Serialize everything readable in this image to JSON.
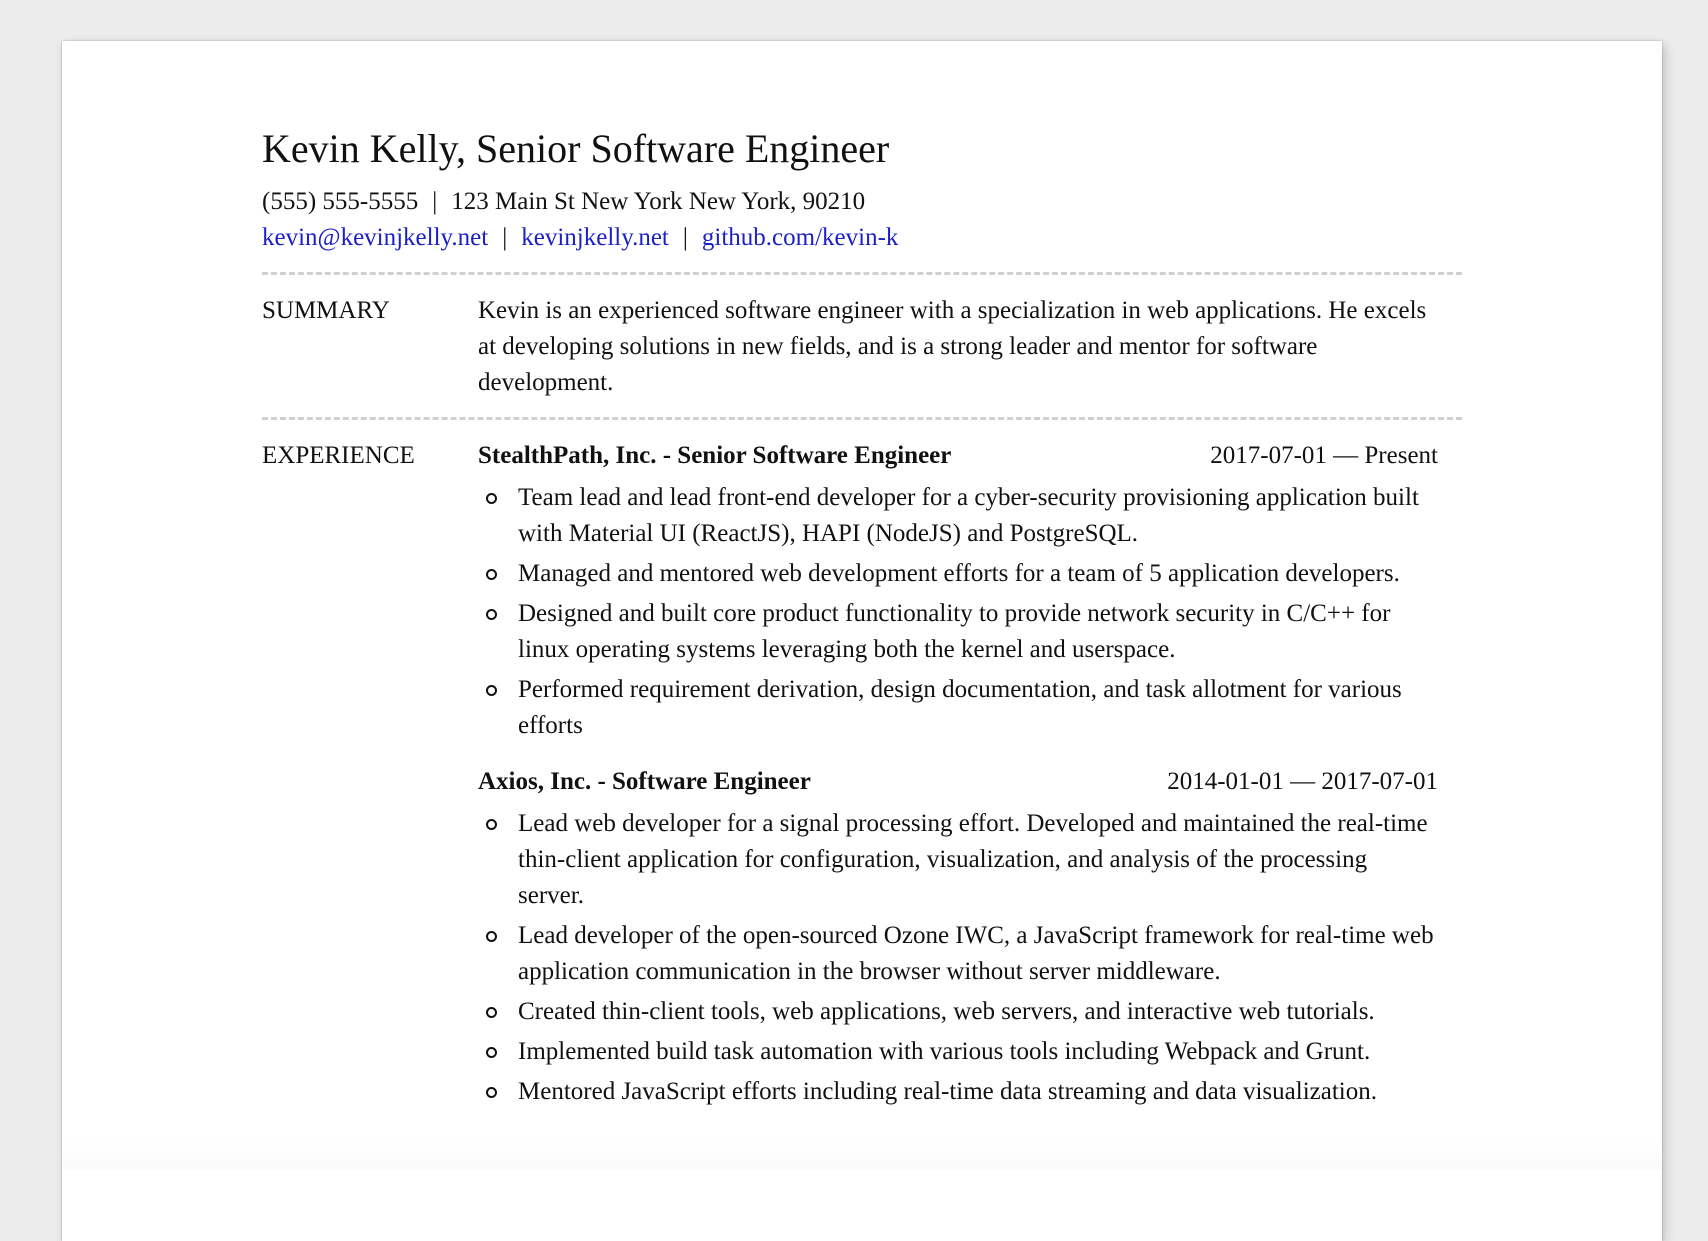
{
  "header": {
    "name_title": "Kevin Kelly, Senior Software Engineer",
    "phone": "(555) 555-5555",
    "address": "123 Main St New York New York, 90210",
    "separator": "|",
    "email": "kevin@kevinjkelly.net",
    "website": "kevinjkelly.net",
    "github": "github.com/kevin-k"
  },
  "summary": {
    "label": "SUMMARY",
    "text": "Kevin is an experienced software engineer with a specialization in web applications. He excels at developing solutions in new fields, and is a strong leader and mentor for software development."
  },
  "experience": {
    "label": "EXPERIENCE",
    "jobs": [
      {
        "title": "StealthPath, Inc. - Senior Software Engineer",
        "dates": "2017-07-01 — Present",
        "bullets": [
          "Team lead and lead front-end developer for a cyber-security provisioning application built with Material UI (ReactJS), HAPI (NodeJS) and PostgreSQL.",
          "Managed and mentored web development efforts for a team of 5 application developers.",
          "Designed and built core product functionality to provide network security in C/C++ for linux operating systems leveraging both the kernel and userspace.",
          "Performed requirement derivation, design documentation, and task allotment for various efforts"
        ]
      },
      {
        "title": "Axios, Inc. - Software Engineer",
        "dates": "2014-01-01 — 2017-07-01",
        "bullets": [
          "Lead web developer for a signal processing effort. Developed and maintained the real-time thin-client application for configuration, visualization, and analysis of the processing server.",
          "Lead developer of the open-sourced Ozone IWC, a JavaScript framework for real-time web application communication in the browser without server middleware.",
          "Created thin-client tools, web applications, web servers, and interactive web tutorials.",
          "Implemented build task automation with various tools including Webpack and Grunt.",
          "Mentored JavaScript efforts including real-time data streaming and data visualization."
        ]
      }
    ]
  },
  "colors": {
    "link": "#1a1fc8",
    "rule": "#d0d0d0",
    "background": "#ececec"
  }
}
